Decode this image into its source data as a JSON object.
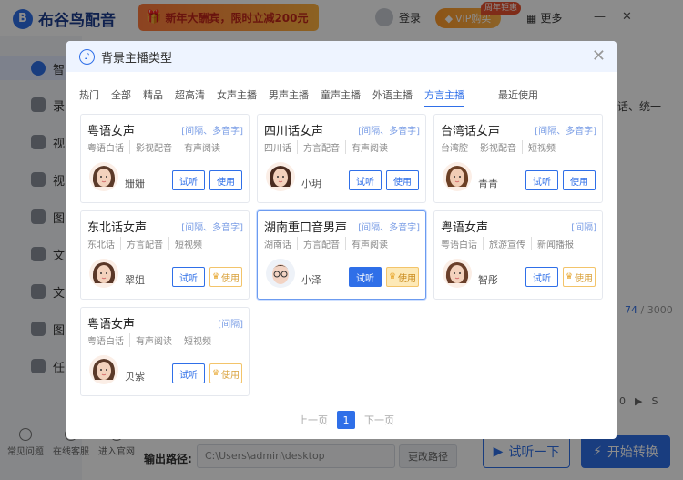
{
  "app": {
    "logo_mark": "B",
    "name": "布谷鸟配音",
    "promo_text": "新年大酬宾，限时立减200元",
    "login": "登录",
    "vip": "VIP购买",
    "anniv_tag": "周年钜惠",
    "more": "更多",
    "right_snippet": "话、统一",
    "char_count_num": "74",
    "char_count_total": " / 3000",
    "side_pager": "0",
    "side_pager_s": "S",
    "output_label": "输出路径:",
    "output_path": "C:\\Users\\admin\\desktop",
    "change_path": "更改路径",
    "try": "试听一下",
    "start": "开始转换",
    "bottom_links": [
      "常见问题",
      "在线客服",
      "进入官网"
    ]
  },
  "sidebar": {
    "items": [
      "智",
      "录",
      "视",
      "视",
      "图",
      "文",
      "文",
      "图",
      "任"
    ]
  },
  "modal": {
    "title": "背景主播类型",
    "tabs": [
      "热门",
      "全部",
      "精品",
      "超高清",
      "女声主播",
      "男声主播",
      "童声主播",
      "外语主播",
      "方言主播",
      "最近使用"
    ],
    "active_tab": 8,
    "pagination": {
      "prev": "上一页",
      "current": "1",
      "next": "下一页"
    }
  },
  "cards": [
    {
      "title": "粤语女声",
      "badge": "[间隔、多音字]",
      "tags": [
        "粤语白话",
        "影视配音",
        "有声阅读"
      ],
      "name": "姗姗",
      "listen": "试听",
      "use": "使用",
      "vip": false
    },
    {
      "title": "四川话女声",
      "badge": "[间隔、多音字]",
      "tags": [
        "四川话",
        "方言配音",
        "有声阅读"
      ],
      "name": "小玥",
      "listen": "试听",
      "use": "使用",
      "vip": false
    },
    {
      "title": "台湾话女声",
      "badge": "[间隔、多音字]",
      "tags": [
        "台湾腔",
        "影视配音",
        "短视频"
      ],
      "name": "青青",
      "listen": "试听",
      "use": "使用",
      "vip": false
    },
    {
      "title": "东北话女声",
      "badge": "[间隔、多音字]",
      "tags": [
        "东北话",
        "方言配音",
        "短视频"
      ],
      "name": "翠姐",
      "listen": "试听",
      "use": "使用",
      "vip": true
    },
    {
      "title": "湖南重口音男声",
      "badge": "[间隔、多音字]",
      "tags": [
        "湖南话",
        "方言配音",
        "有声阅读"
      ],
      "name": "小泽",
      "listen": "试听",
      "use": "使用",
      "vip": true
    },
    {
      "title": "粤语女声",
      "badge": "[间隔]",
      "tags": [
        "粤语白话",
        "旅游宣传",
        "新闻播报"
      ],
      "name": "智彤",
      "listen": "试听",
      "use": "使用",
      "vip": true
    },
    {
      "title": "粤语女声",
      "badge": "[间隔]",
      "tags": [
        "粤语白话",
        "有声阅读",
        "短视频"
      ],
      "name": "贝紫",
      "listen": "试听",
      "use": "使用",
      "vip": true
    }
  ]
}
